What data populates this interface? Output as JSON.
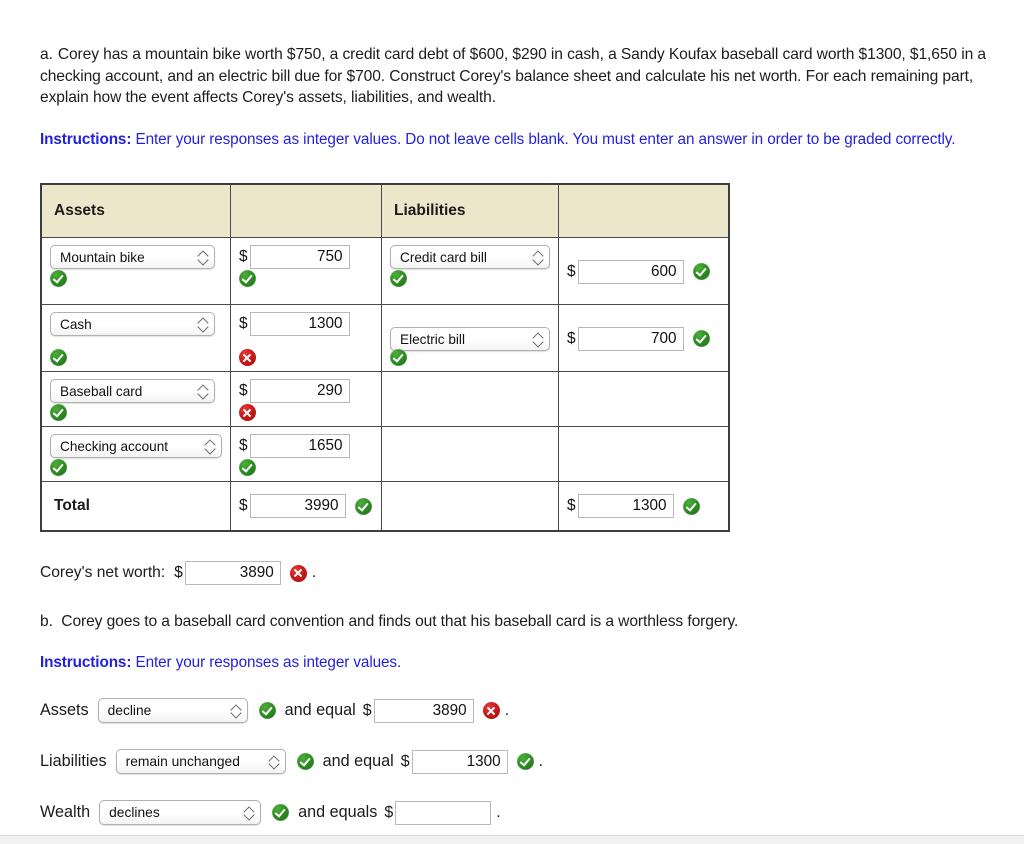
{
  "question": {
    "lead": "a.",
    "text": "Corey has a mountain bike worth $750, a credit card debt of $600, $290 in cash, a Sandy Koufax baseball card worth $1300, $1,650 in a checking account, and an electric bill due for $700. Construct Corey's balance sheet and calculate his net worth. For each remaining part, explain how the event affects Corey's assets, liabilities, and wealth."
  },
  "instructions": {
    "label": "Instructions:",
    "text": " Enter your responses as integer values. Do not leave cells blank. You must enter an answer in order to be graded correctly."
  },
  "table": {
    "headers": {
      "assets": "Assets",
      "assets_amount": "",
      "liabilities": "Liabilities",
      "liabilities_amount": ""
    },
    "rows": [
      {
        "asset_label": "Mountain bike",
        "asset_status": "correct",
        "asset_dollar": "$",
        "asset_value": "750",
        "asset_value_status": "correct",
        "liab_label": "Credit card bill",
        "liab_status": "correct",
        "liab_dollar": "$",
        "liab_value": "600",
        "liab_value_status": "correct"
      },
      {
        "asset_label": "Cash",
        "asset_status": "correct",
        "asset_dollar": "$",
        "asset_value": "1300",
        "asset_value_status": "incorrect",
        "liab_label": "Electric bill",
        "liab_status": "correct",
        "liab_dollar": "$",
        "liab_value": "700",
        "liab_value_status": "correct"
      },
      {
        "asset_label": "Baseball card",
        "asset_status": "correct",
        "asset_dollar": "$",
        "asset_value": "290",
        "asset_value_status": "incorrect",
        "liab_label": "",
        "liab_status": "none",
        "liab_dollar": "",
        "liab_value": "",
        "liab_value_status": "none"
      },
      {
        "asset_label": "Checking account",
        "asset_status": "correct",
        "asset_dollar": "$",
        "asset_value": "1650",
        "asset_value_status": "correct",
        "liab_label": "",
        "liab_status": "none",
        "liab_dollar": "",
        "liab_value": "",
        "liab_value_status": "none"
      }
    ],
    "total": {
      "label": "Total",
      "assets_dollar": "$",
      "assets_value": "3990",
      "assets_status": "correct",
      "liab_dollar": "$",
      "liab_value": "1300",
      "liab_status": "correct"
    }
  },
  "net_worth": {
    "label": "Corey's net worth:",
    "dollar": "$",
    "value": "3890",
    "status": "incorrect",
    "period": "."
  },
  "part_b": {
    "lead": "b.",
    "text": "Corey goes to a baseball card convention and finds out that his baseball card is a worthless forgery.",
    "instructions_label": "Instructions:",
    "instructions_text": "  Enter your responses as integer values."
  },
  "answers": [
    {
      "term": "Assets",
      "selection": "decline",
      "select_status": "correct",
      "connector": "and equal",
      "dollar": "$",
      "value": "3890",
      "value_status": "incorrect",
      "period": "."
    },
    {
      "term": "Liabilities",
      "selection": "remain unchanged",
      "select_status": "correct",
      "connector": "and equal",
      "dollar": "$",
      "value": "1300",
      "value_status": "correct",
      "period": "."
    },
    {
      "term": "Wealth",
      "selection": "declines",
      "select_status": "correct",
      "connector": "and equals",
      "dollar": "$",
      "value": "",
      "value_status": "none",
      "period": "."
    }
  ],
  "colors": {
    "header_bg": "#ece6ca",
    "instruction_blue": "#2222dd",
    "correct_green": "#2e8b23",
    "incorrect_red": "#c81a1a"
  }
}
